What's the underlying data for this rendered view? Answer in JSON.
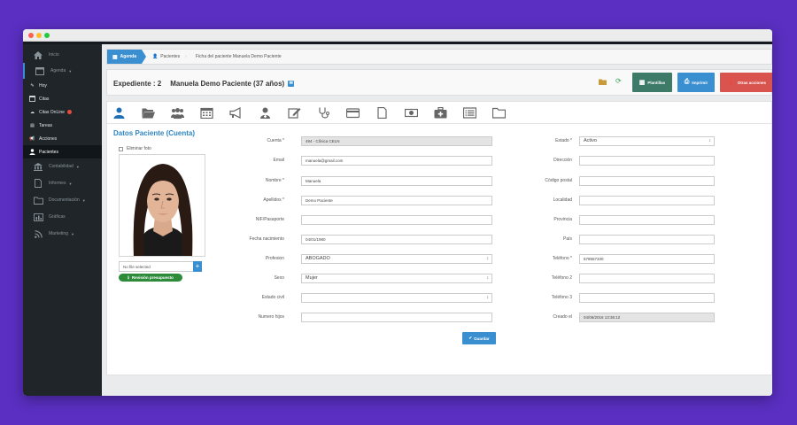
{
  "sidebar": {
    "items": [
      {
        "label": "Inicio",
        "icon": "home-icon"
      },
      {
        "label": "Agenda",
        "icon": "calendar-icon"
      },
      {
        "label": "Hoy",
        "icon": "edit-icon"
      },
      {
        "label": "Citas",
        "icon": "calendar-small-icon"
      },
      {
        "label": "Citas OnLine",
        "icon": "cloud-icon"
      },
      {
        "label": "Tareas",
        "icon": "tasks-icon"
      },
      {
        "label": "Acciones",
        "icon": "megaphone-icon"
      },
      {
        "label": "Pacientes",
        "icon": "user-icon"
      },
      {
        "label": "Contabilidad",
        "icon": "bank-icon"
      },
      {
        "label": "Informes",
        "icon": "document-icon"
      },
      {
        "label": "Documentación",
        "icon": "folder-icon"
      },
      {
        "label": "Gráficas",
        "icon": "bar-chart-icon"
      },
      {
        "label": "Marketing",
        "icon": "rss-icon"
      }
    ],
    "notification_color": "#e74c3c"
  },
  "breadcrumb": {
    "agenda": "Agenda",
    "pacientes": "Pacientes",
    "current": "Ficha del paciente Manuela Demo Paciente"
  },
  "header": {
    "expediente": "Expediente : 2",
    "patient": "Manuela Demo Paciente (37 años)",
    "buttons": {
      "plantillas": "Plantillas",
      "imprimir": "Imprimir",
      "otras": "Otras acciones"
    },
    "colors": {
      "plantillas": "#3d7a68",
      "imprimir": "#3a8fd0",
      "otras": "#d9534f"
    }
  },
  "tabs": [
    "user-icon",
    "folder-open-icon",
    "group-icon",
    "calendar-icon",
    "megaphone-icon",
    "doctor-icon",
    "edit-icon",
    "stethoscope-icon",
    "credit-card-icon",
    "file-icon",
    "money-icon",
    "medkit-icon",
    "list-icon",
    "folder-icon"
  ],
  "section": {
    "title": "Datos Paciente (Cuenta)",
    "eliminar_foto": "Eliminar foto",
    "file_placeholder": "No file selected",
    "revision": "Revisión presupuesto"
  },
  "form": {
    "left": [
      {
        "label": "Cuenta *",
        "value": "494 - Clínica CELN"
      },
      {
        "label": "Email",
        "value": "manuela@gmail.com"
      },
      {
        "label": "Nombre *",
        "value": "Manuela"
      },
      {
        "label": "Apellidos *",
        "value": "Demo Paciente"
      },
      {
        "label": "NIF/Pasaporte",
        "value": ""
      },
      {
        "label": "Fecha nacimiento",
        "value": "04/01/1980"
      },
      {
        "label": "Profesion",
        "value": "ABOGADO"
      },
      {
        "label": "Sexo",
        "value": "Mujer"
      },
      {
        "label": "Estado civil",
        "value": ""
      },
      {
        "label": "Numero hijos",
        "value": ""
      }
    ],
    "right": [
      {
        "label": "Estado *",
        "value": "Activo"
      },
      {
        "label": "Dirección",
        "value": ""
      },
      {
        "label": "Código postal",
        "value": ""
      },
      {
        "label": "Localidad",
        "value": ""
      },
      {
        "label": "Provincia",
        "value": ""
      },
      {
        "label": "País",
        "value": ""
      },
      {
        "label": "Teléfono *",
        "value": "678557330"
      },
      {
        "label": "Teléfono 2",
        "value": ""
      },
      {
        "label": "Teléfono 3",
        "value": ""
      },
      {
        "label": "Creado el",
        "value": "04/06/2016 13:36:12"
      }
    ],
    "save": "Guardar"
  }
}
